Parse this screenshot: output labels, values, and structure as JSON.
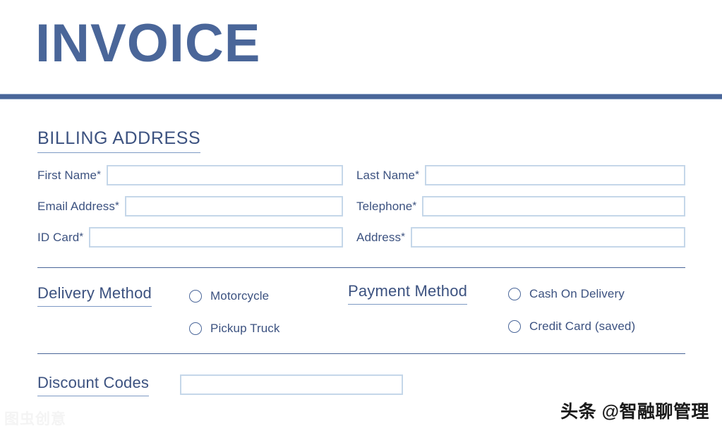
{
  "document": {
    "title": "INVOICE"
  },
  "billing": {
    "heading": "BILLING ADDRESS",
    "fields": [
      {
        "label": "First Name",
        "required": "*",
        "value": "",
        "placeholder": ""
      },
      {
        "label": "Last Name",
        "required": "*",
        "value": "",
        "placeholder": ""
      },
      {
        "label": "Email Address",
        "required": "*",
        "value": "",
        "placeholder": ""
      },
      {
        "label": "Telephone",
        "required": "*",
        "value": "",
        "placeholder": ""
      },
      {
        "label": "ID Card",
        "required": "*",
        "value": "",
        "placeholder": ""
      },
      {
        "label": "Address",
        "required": "*",
        "value": "",
        "placeholder": ""
      }
    ]
  },
  "delivery": {
    "heading": "Delivery Method",
    "options": [
      {
        "label": "Motorcycle",
        "selected": false
      },
      {
        "label": "Pickup Truck",
        "selected": false
      }
    ]
  },
  "payment": {
    "heading": "Payment Method",
    "options": [
      {
        "label": "Cash On Delivery",
        "selected": false
      },
      {
        "label": "Credit Card (saved)",
        "selected": false
      }
    ]
  },
  "discount": {
    "heading": "Discount Codes",
    "value": "",
    "placeholder": ""
  },
  "watermarks": {
    "brand": "头条 @智融聊管理",
    "corner": "图虫创意"
  },
  "colors": {
    "title_blue": "#4a6699",
    "label_blue": "#3c5280",
    "input_border": "#c5d7e9",
    "rule_blue": "#4a6699",
    "heading_underline": "#7e9ac4"
  }
}
